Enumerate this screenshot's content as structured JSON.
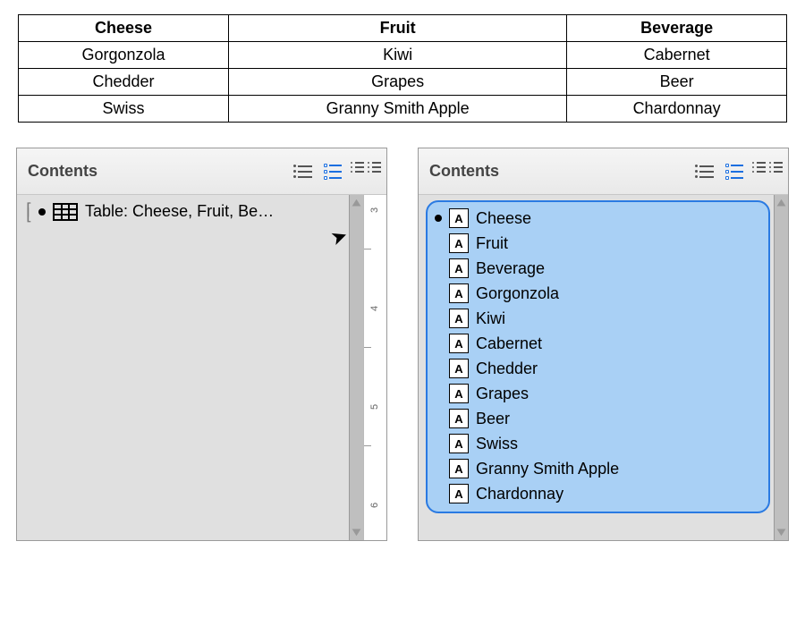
{
  "table": {
    "headers": [
      "Cheese",
      "Fruit",
      "Beverage"
    ],
    "rows": [
      [
        "Gorgonzola",
        "Kiwi",
        "Cabernet"
      ],
      [
        "Chedder",
        "Grapes",
        "Beer"
      ],
      [
        "Swiss",
        "Granny Smith Apple",
        "Chardonnay"
      ]
    ]
  },
  "panels": {
    "left": {
      "title": "Contents",
      "item_label": "Table: Cheese, Fruit, Be…"
    },
    "right": {
      "title": "Contents",
      "items": [
        "Cheese",
        "Fruit",
        "Beverage",
        "Gorgonzola",
        "Kiwi",
        "Cabernet",
        "Chedder",
        "Grapes",
        "Beer",
        "Swiss",
        "Granny Smith Apple",
        "Chardonnay"
      ]
    }
  },
  "ruler_labels": [
    "3",
    "4",
    "5",
    "6"
  ]
}
